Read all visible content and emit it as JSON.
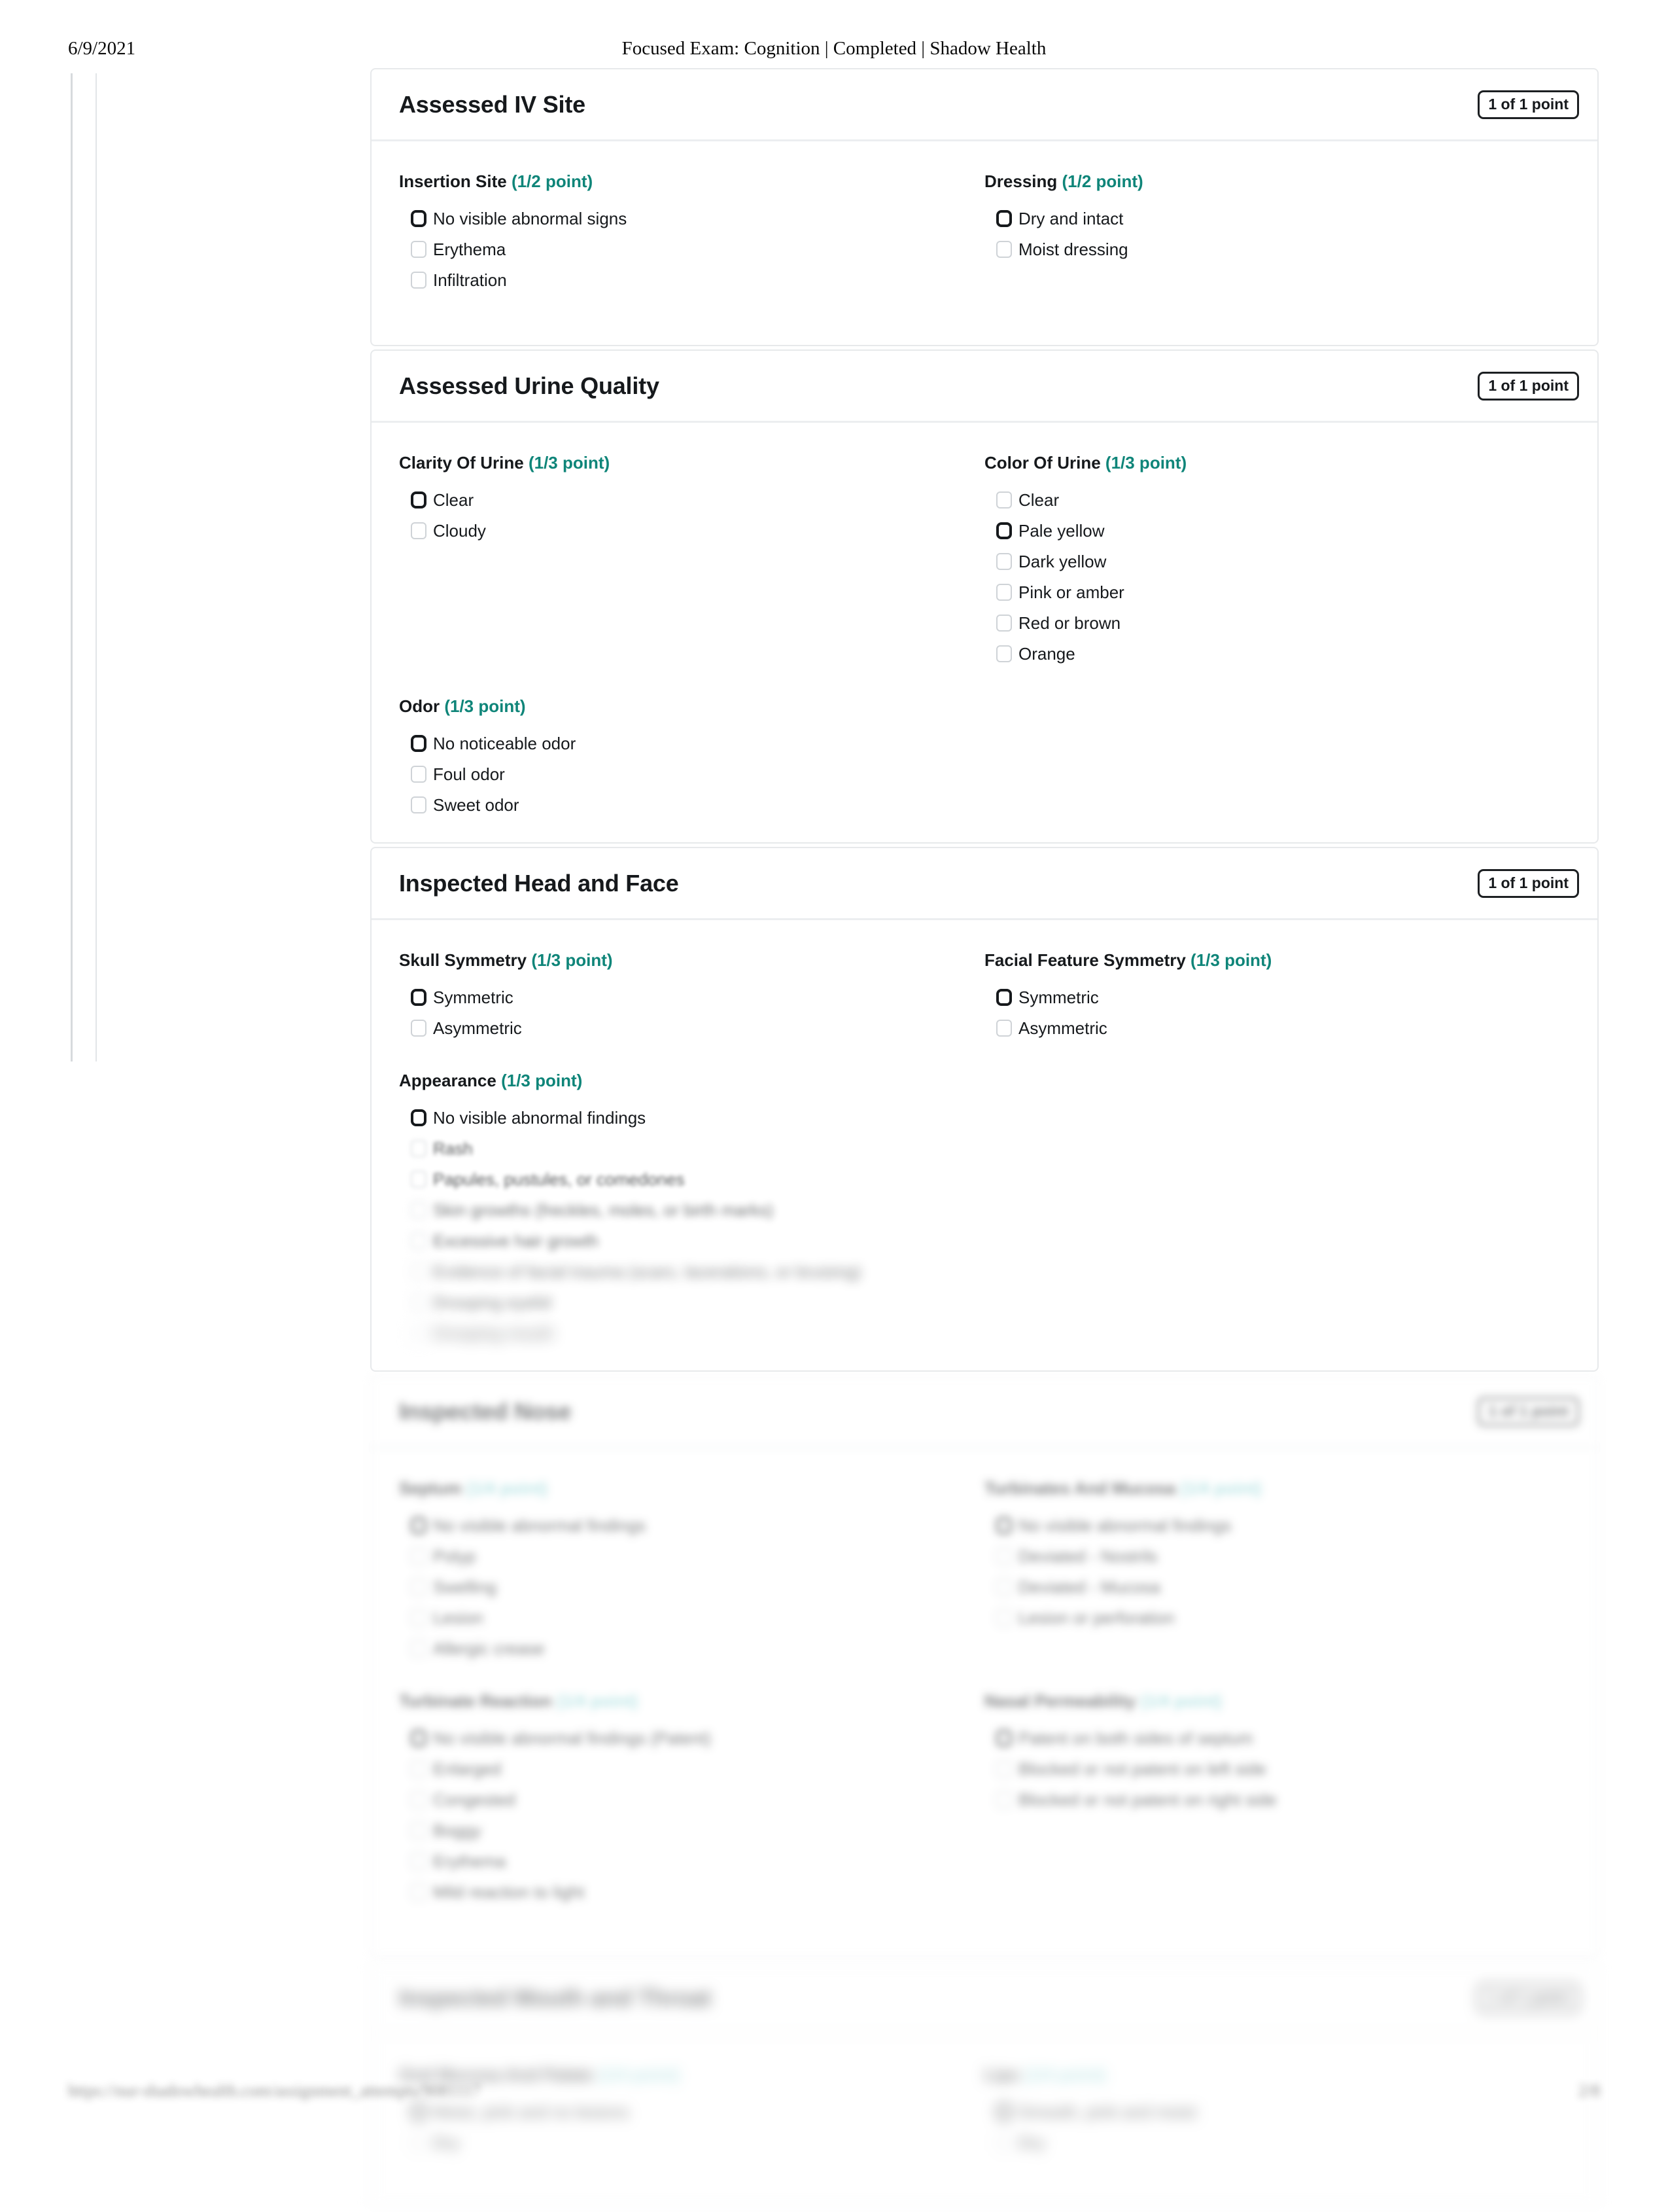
{
  "print_header": {
    "date": "6/9/2021",
    "title": "Focused Exam: Cognition | Completed | Shadow Health"
  },
  "print_footer": {
    "url": "https://nur-shadowhealth.com/assignment_attempts/9081117",
    "page": "2/8"
  },
  "sections": [
    {
      "id": "assessed-iv-site",
      "title": "Assessed IV Site",
      "points_badge": "1 of 1 point",
      "blur": "none",
      "groups": [
        {
          "label": "Insertion Site",
          "points": "(1/2 point)",
          "options": [
            {
              "label": "No visible abnormal signs",
              "selected": true
            },
            {
              "label": "Erythema",
              "selected": false
            },
            {
              "label": "Infiltration",
              "selected": false
            }
          ]
        },
        {
          "label": "Dressing",
          "points": "(1/2 point)",
          "options": [
            {
              "label": "Dry and intact",
              "selected": true
            },
            {
              "label": "Moist dressing",
              "selected": false
            }
          ]
        }
      ]
    },
    {
      "id": "assessed-urine-quality",
      "title": "Assessed Urine Quality",
      "points_badge": "1 of 1 point",
      "blur": "none",
      "groups": [
        {
          "label": "Clarity Of Urine",
          "points": "(1/3 point)",
          "options": [
            {
              "label": "Clear",
              "selected": true
            },
            {
              "label": "Cloudy",
              "selected": false
            }
          ]
        },
        {
          "label": "Color Of Urine",
          "points": "(1/3 point)",
          "options": [
            {
              "label": "Clear",
              "selected": false
            },
            {
              "label": "Pale yellow",
              "selected": true
            },
            {
              "label": "Dark yellow",
              "selected": false
            },
            {
              "label": "Pink or amber",
              "selected": false
            },
            {
              "label": "Red or brown",
              "selected": false
            },
            {
              "label": "Orange",
              "selected": false
            }
          ]
        },
        {
          "label": "Odor",
          "points": "(1/3 point)",
          "options": [
            {
              "label": "No noticeable odor",
              "selected": true
            },
            {
              "label": "Foul odor",
              "selected": false
            },
            {
              "label": "Sweet odor",
              "selected": false
            }
          ]
        }
      ]
    },
    {
      "id": "inspected-head-and-face",
      "title": "Inspected Head and Face",
      "points_badge": "1 of 1 point",
      "blur": "none",
      "groups": [
        {
          "label": "Skull Symmetry",
          "points": "(1/3 point)",
          "options": [
            {
              "label": "Symmetric",
              "selected": true
            },
            {
              "label": "Asymmetric",
              "selected": false
            }
          ]
        },
        {
          "label": "Facial Feature Symmetry",
          "points": "(1/3 point)",
          "options": [
            {
              "label": "Symmetric",
              "selected": true
            },
            {
              "label": "Asymmetric",
              "selected": false
            }
          ]
        },
        {
          "label": "Appearance",
          "points": "(1/3 point)",
          "blur_options_from": 1,
          "options": [
            {
              "label": "No visible abnormal findings",
              "selected": true
            },
            {
              "label": "Rash",
              "selected": false
            },
            {
              "label": "Papules, pustules, or comedones",
              "selected": false
            },
            {
              "label": "Skin growths (freckles, moles, or birth marks)",
              "selected": false
            },
            {
              "label": "Excessive hair growth",
              "selected": false
            },
            {
              "label": "Evidence of facial trauma (scars, lacerations, or bruising)",
              "selected": false
            },
            {
              "label": "Drooping eyelid",
              "selected": false
            },
            {
              "label": "Drooping mouth",
              "selected": false
            }
          ]
        }
      ]
    },
    {
      "id": "inspected-nose",
      "title": "Inspected Nose",
      "points_badge": "1 of 1 point",
      "blur": "heavy",
      "groups": [
        {
          "label": "Septum",
          "points": "(1/4 point)",
          "options": [
            {
              "label": "No visible abnormal findings",
              "selected": true
            },
            {
              "label": "Polyp",
              "selected": false
            },
            {
              "label": "Swelling",
              "selected": false
            },
            {
              "label": "Lesion",
              "selected": false
            },
            {
              "label": "Allergic crease",
              "selected": false
            }
          ]
        },
        {
          "label": "Turbinates And Mucosa",
          "points": "(1/4 point)",
          "options": [
            {
              "label": "No visible abnormal findings",
              "selected": true
            },
            {
              "label": "Deviated - Nostrils",
              "selected": false
            },
            {
              "label": "Deviated - Mucosa",
              "selected": false
            },
            {
              "label": "Lesion or perforation",
              "selected": false
            }
          ]
        },
        {
          "label": "Turbinate Reaction",
          "points": "(1/4 point)",
          "options": [
            {
              "label": "No visible abnormal findings (Patent)",
              "selected": true
            },
            {
              "label": "Enlarged",
              "selected": false
            },
            {
              "label": "Congested",
              "selected": false
            },
            {
              "label": "Boggy",
              "selected": false
            },
            {
              "label": "Erythema",
              "selected": false
            },
            {
              "label": "Mild reaction to light",
              "selected": false
            }
          ]
        },
        {
          "label": "Nasal Permeability",
          "points": "(1/4 point)",
          "options": [
            {
              "label": "Patent on both sides of septum",
              "selected": true
            },
            {
              "label": "Blocked or not patent on left side",
              "selected": false
            },
            {
              "label": "Blocked or not patent on right side",
              "selected": false
            }
          ]
        }
      ]
    },
    {
      "id": "inspected-mouth-and-throat",
      "title": "Inspected Mouth and Throat",
      "points_badge": "1 of 1 point",
      "blur": "heavy-2",
      "groups": [
        {
          "label": "Oral Mucosa And Palate",
          "points": "(1/4 point)",
          "options": [
            {
              "label": "Moist, pink and no lesions",
              "selected": true
            },
            {
              "label": "Dry",
              "selected": false
            }
          ]
        },
        {
          "label": "Lips",
          "points": "(1/4 point)",
          "options": [
            {
              "label": "Smooth, pink and moist",
              "selected": true
            },
            {
              "label": "Dry",
              "selected": false
            }
          ]
        }
      ]
    }
  ]
}
